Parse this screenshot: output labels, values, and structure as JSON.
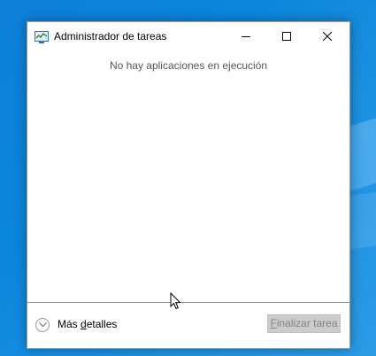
{
  "window": {
    "title": "Administrador de tareas",
    "controls": {
      "minimize_icon": "minimize-icon",
      "maximize_icon": "maximize-icon",
      "close_icon": "close-icon"
    }
  },
  "main": {
    "empty_message": "No hay aplicaciones en ejecución"
  },
  "footer": {
    "details_prefix": "Más ",
    "details_access_letter": "d",
    "details_rest": "etalles",
    "end_task_access_letter": "F",
    "end_task_rest": "inalizar tarea",
    "end_task_enabled": false
  },
  "colors": {
    "desktop": "#0a86dc",
    "window_bg": "#ffffff",
    "disabled_button_bg": "#cccccc",
    "disabled_button_text": "#838383"
  }
}
